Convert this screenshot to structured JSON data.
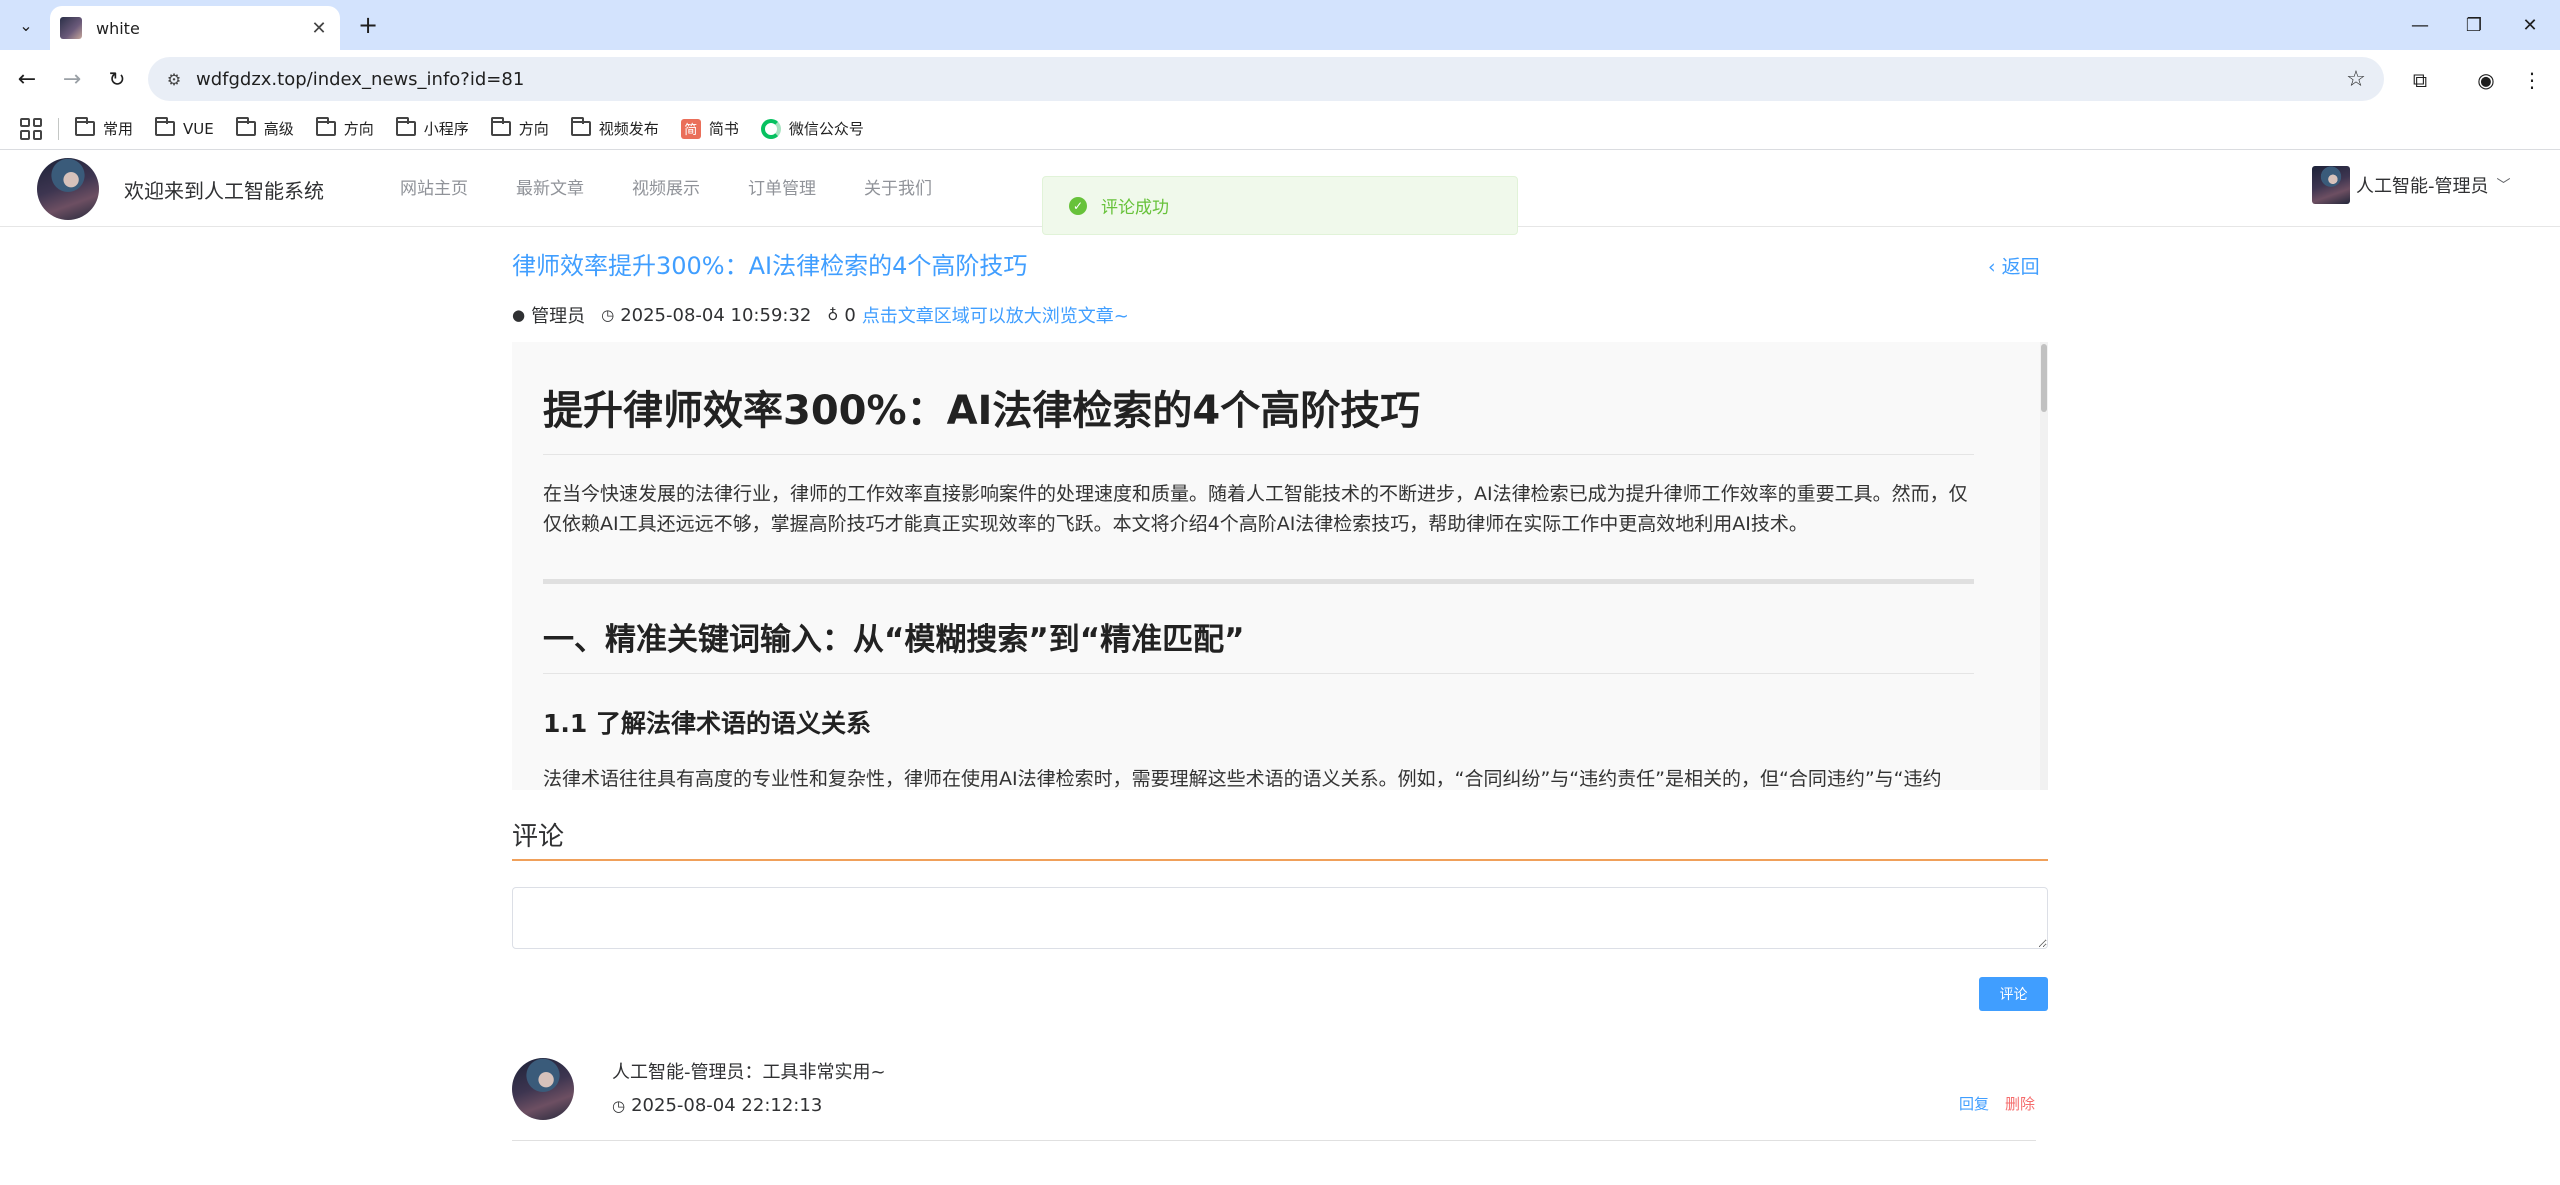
{
  "browser": {
    "tab_title": "white",
    "url": "wdfgdzx.top/index_news_info?id=81",
    "bookmarks": [
      {
        "label": "常用",
        "icon": "folder-icon"
      },
      {
        "label": "VUE",
        "icon": "folder-icon"
      },
      {
        "label": "高级",
        "icon": "folder-icon"
      },
      {
        "label": "方向",
        "icon": "folder-icon"
      },
      {
        "label": "小程序",
        "icon": "folder-icon"
      },
      {
        "label": "方向",
        "icon": "folder-icon"
      },
      {
        "label": "视频发布",
        "icon": "folder-icon"
      },
      {
        "label": "简书",
        "icon": "jianshu-icon"
      },
      {
        "label": "微信公众号",
        "icon": "wechat-icon"
      }
    ]
  },
  "site": {
    "title": "欢迎来到人工智能系统",
    "nav": [
      "网站主页",
      "最新文章",
      "视频展示",
      "订单管理",
      "关于我们"
    ],
    "user_name": "人工智能-管理员",
    "toast": "评论成功"
  },
  "article": {
    "title": "律师效率提升300%：AI法律检索的4个高阶技巧",
    "back": "返回",
    "author": "管理员",
    "datetime": "2025-08-04 10:59:32",
    "views": "0",
    "tip": "点击文章区域可以放大浏览文章~",
    "content": {
      "h1": "提升律师效率300%：AI法律检索的4个高阶技巧",
      "intro": "在当今快速发展的法律行业，律师的工作效率直接影响案件的处理速度和质量。随着人工智能技术的不断进步，AI法律检索已成为提升律师工作效率的重要工具。然而，仅仅依赖AI工具还远远不够，掌握高阶技巧才能真正实现效率的飞跃。本文将介绍4个高阶AI法律检索技巧，帮助律师在实际工作中更高效地利用AI技术。",
      "h2": "一、精准关键词输入：从“模糊搜索”到“精准匹配”",
      "h3": "1.1 了解法律术语的语义关系",
      "p2": "法律术语往往具有高度的专业性和复杂性，律师在使用AI法律检索时，需要理解这些术语的语义关系。例如，“合同纠纷”与“违约责任”是相关的，但“合同违约”与“违约金”则属于不同的法律概念。"
    }
  },
  "comments": {
    "heading": "评论",
    "submit": "评论",
    "items": [
      {
        "text": "人工智能-管理员：工具非常实用~",
        "time": "2025-08-04 22:12:13",
        "reply": "回复",
        "delete": "删除"
      }
    ]
  }
}
